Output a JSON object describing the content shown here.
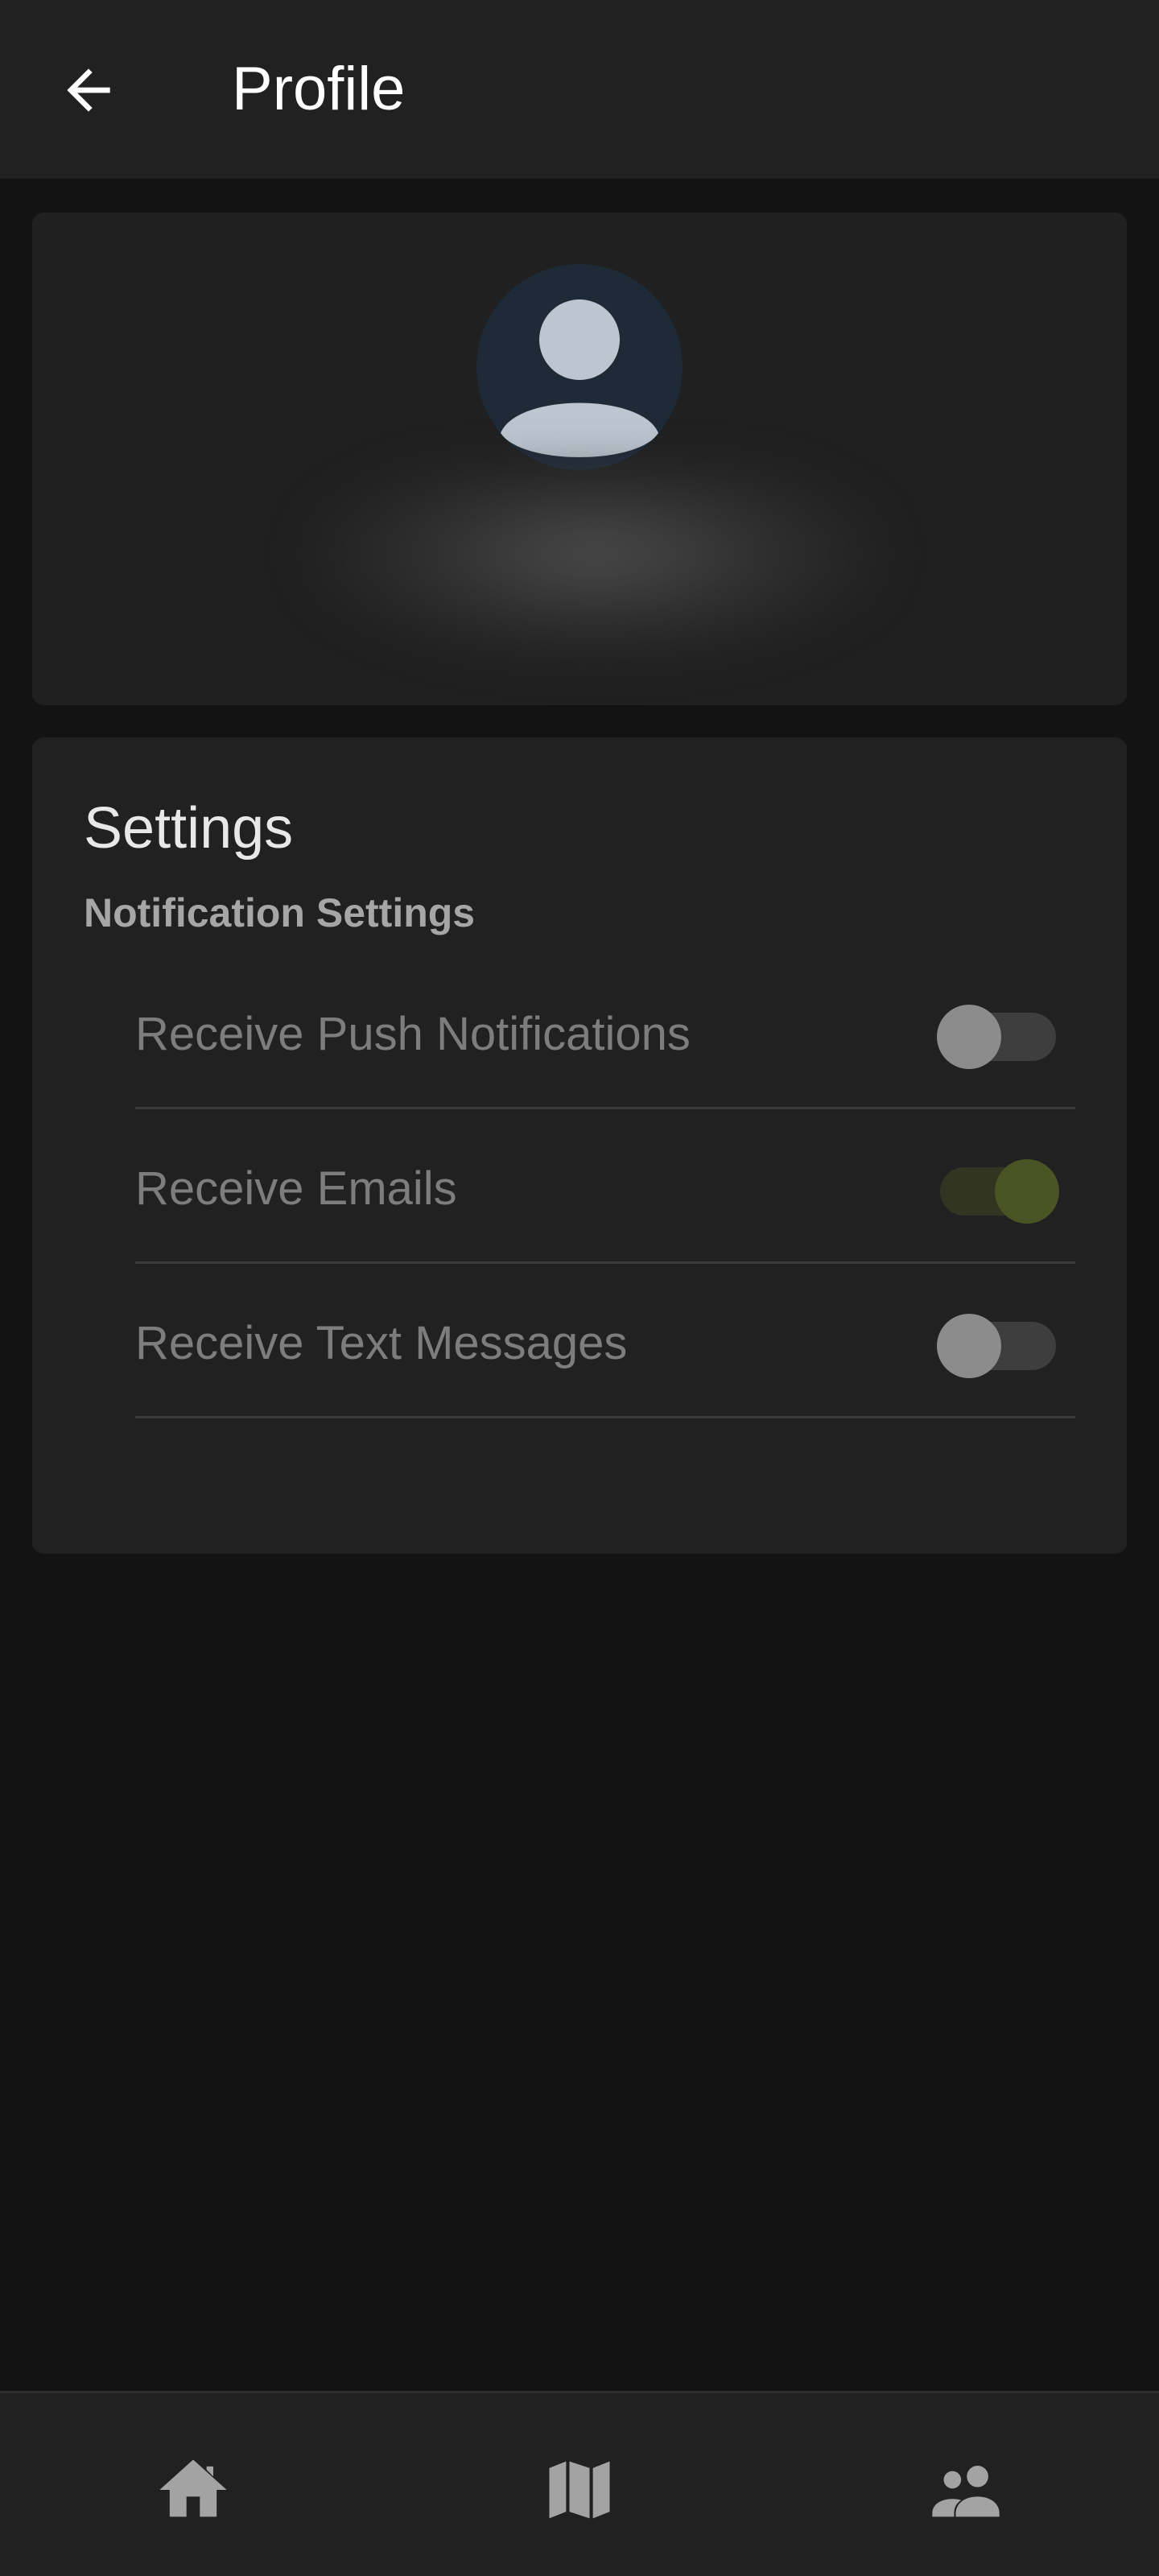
{
  "app_bar": {
    "title": "Profile",
    "back_icon": "arrow-back-icon"
  },
  "profile": {
    "avatar_icon": "person-icon"
  },
  "settings": {
    "title": "Settings",
    "subtitle": "Notification Settings",
    "items": [
      {
        "label": "Receive Push Notifications",
        "enabled": false
      },
      {
        "label": "Receive Emails",
        "enabled": true
      },
      {
        "label": "Receive Text Messages",
        "enabled": false
      }
    ]
  },
  "bottom_nav": {
    "items": [
      {
        "icon": "home-icon"
      },
      {
        "icon": "map-icon"
      },
      {
        "icon": "people-icon"
      }
    ]
  },
  "colors": {
    "background": "#131313",
    "surface": "#212121",
    "toggle_on_thumb": "#4b5425",
    "toggle_off_thumb": "#8c8c8c"
  }
}
